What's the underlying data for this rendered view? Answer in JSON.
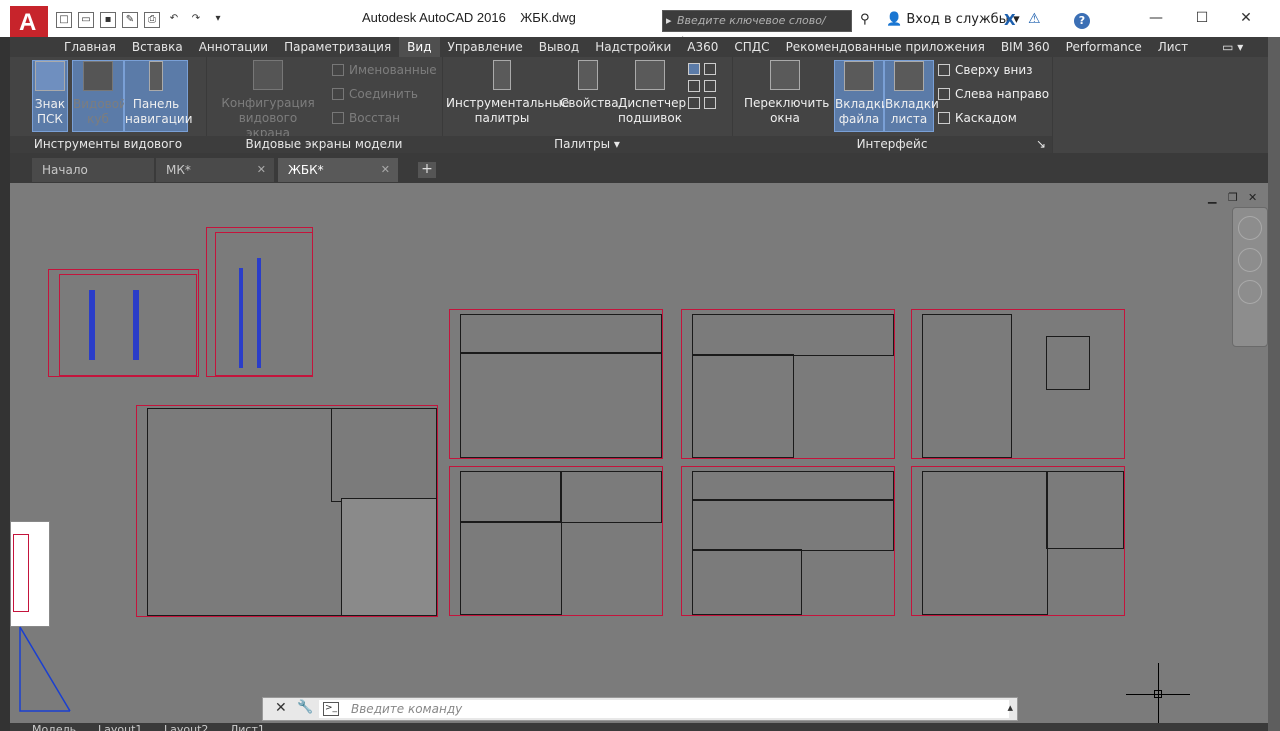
{
  "app": {
    "title": "Autodesk AutoCAD 2016",
    "file": "ЖБК.dwg",
    "logo_letter": "A"
  },
  "search": {
    "placeholder": "Введите ключевое слово/фразу"
  },
  "signin": {
    "label": "Вход в службы"
  },
  "ribbon_tabs": [
    "Главная",
    "Вставка",
    "Аннотации",
    "Параметризация",
    "Вид",
    "Управление",
    "Вывод",
    "Надстройки",
    "А360",
    "СПДС",
    "Рекомендованные приложения",
    "BIM 360",
    "Performance",
    "Лист"
  ],
  "active_ribbon_tab": "Вид",
  "ribbon": {
    "viewport_tools": {
      "title": "Инструменты видового экрана",
      "ucs_icon": "Знак ПСК",
      "viewcube": "Видовой куб",
      "navbar": "Панель навигации"
    },
    "model_viewports": {
      "title": "Видовые экраны модели",
      "config": "Конфигурация видового экрана",
      "named": "Именованные",
      "join": "Соединить",
      "restore": "Восстан"
    },
    "palettes": {
      "title": "Палитры",
      "tool_palettes": "Инструментальные палитры",
      "properties": "Свойства",
      "sheetset": "Диспетчер подшивок"
    },
    "interface": {
      "title": "Интерфейс",
      "switch_windows": "Переключить окна",
      "file_tabs": "Вкладки файла",
      "layout_tabs": "Вкладки листа",
      "top_bottom": "Сверху вниз",
      "left_right": "Слева направо",
      "cascade": "Каскадом"
    }
  },
  "file_tabs": [
    {
      "label": "Начало"
    },
    {
      "label": "МК*"
    },
    {
      "label": "ЖБК*"
    }
  ],
  "active_file_tab": "ЖБК*",
  "command": {
    "placeholder": "Введите команду"
  },
  "layout_tabs": [
    "Модель",
    "Layout1",
    "Layout2",
    "Лист1"
  ],
  "colors": {
    "sheet_border": "#c4143c",
    "canvas": "#7b7b7b",
    "ribbon": "#444444",
    "selected": "#5b7ba8"
  }
}
